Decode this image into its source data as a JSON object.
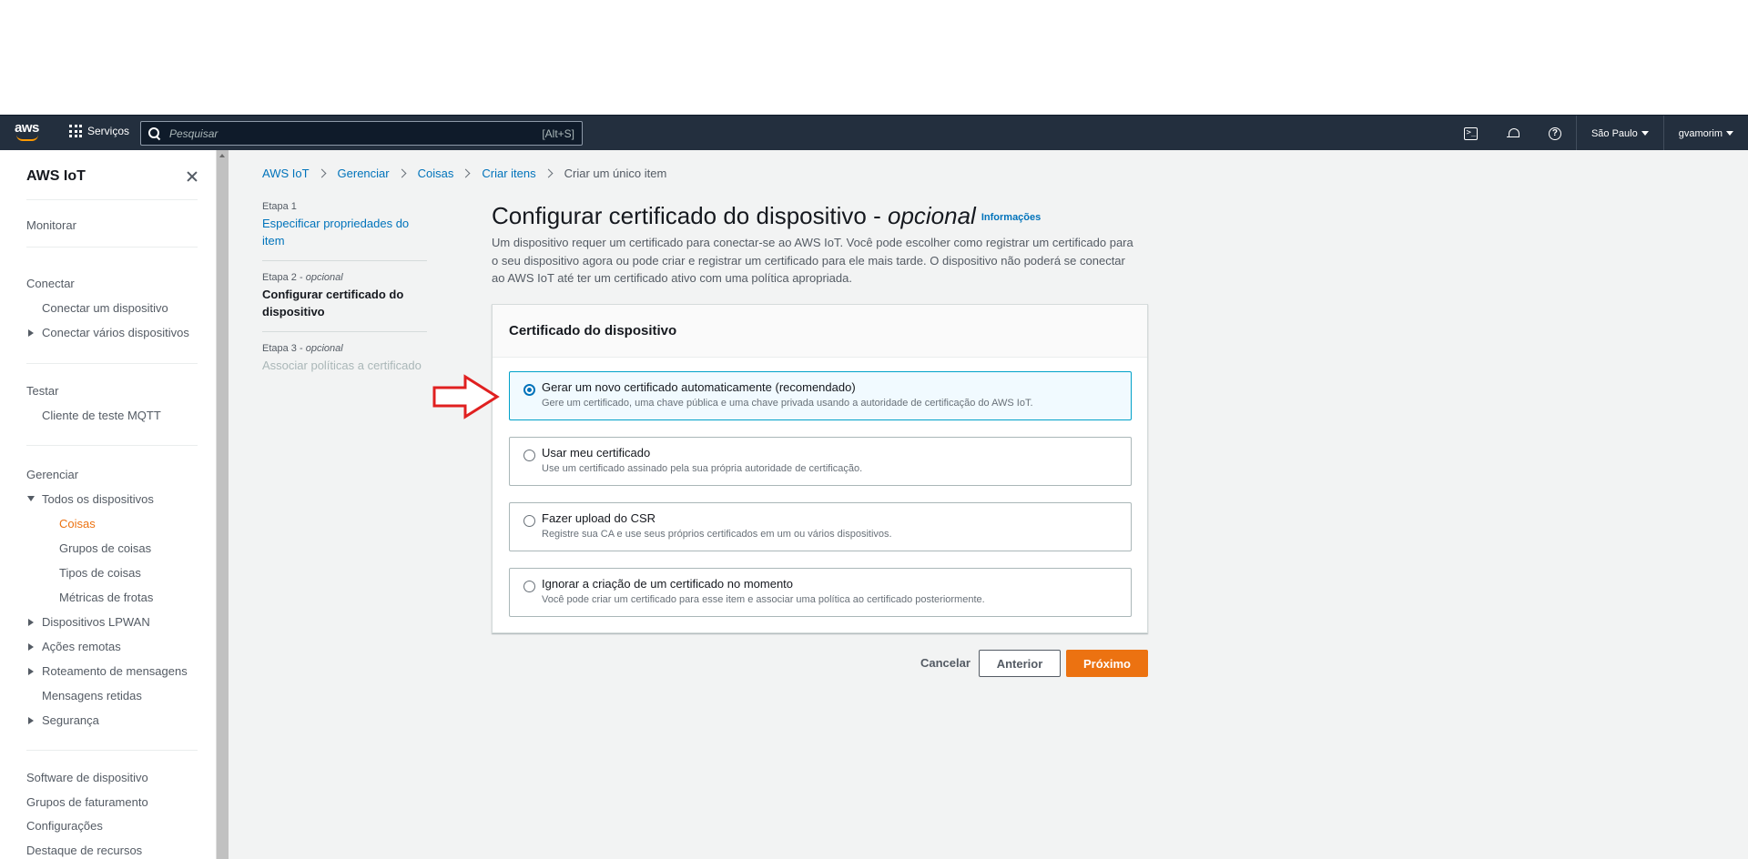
{
  "navbar": {
    "logo_text": "aws",
    "services_label": "Serviços",
    "search_placeholder": "Pesquisar",
    "search_shortcut": "[Alt+S]",
    "region": "São Paulo",
    "account": "gvamorim",
    "icons": [
      "cloudshell-icon",
      "bell-icon",
      "help-icon"
    ]
  },
  "sidebar": {
    "title": "AWS IoT",
    "monitor": "Monitorar",
    "connect": "Conectar",
    "connect_one": "Conectar um dispositivo",
    "connect_many": "Conectar vários dispositivos",
    "test": "Testar",
    "mqtt_client": "Cliente de teste MQTT",
    "manage": "Gerenciar",
    "all_devices": "Todos os dispositivos",
    "things": "Coisas",
    "thing_groups": "Grupos de coisas",
    "thing_types": "Tipos de coisas",
    "fleet_metrics": "Métricas de frotas",
    "lpwan": "Dispositivos LPWAN",
    "remote_actions": "Ações remotas",
    "message_routing": "Roteamento de mensagens",
    "retained_messages": "Mensagens retidas",
    "security": "Segurança",
    "device_software": "Software de dispositivo",
    "billing_groups": "Grupos de faturamento",
    "settings": "Configurações",
    "feature_spotlight": "Destaque de recursos"
  },
  "breadcrumb": {
    "items": [
      "AWS IoT",
      "Gerenciar",
      "Coisas",
      "Criar itens"
    ],
    "current": "Criar um único item"
  },
  "steps": [
    {
      "label": "Etapa 1",
      "optional": "",
      "title": "Especificar propriedades do item"
    },
    {
      "label": "Etapa 2 - ",
      "optional": "opcional",
      "title": "Configurar certificado do dispositivo"
    },
    {
      "label": "Etapa 3 - ",
      "optional": "opcional",
      "title": "Associar políticas a certificado"
    }
  ],
  "page": {
    "title": "Configurar certificado do dispositivo - ",
    "title_optional": "opcional",
    "info_link": "Informações",
    "description": "Um dispositivo requer um certificado para conectar-se ao AWS IoT. Você pode escolher como registrar um certificado para o seu dispositivo agora ou pode criar e registrar um certificado para ele mais tarde. O dispositivo não poderá se conectar ao AWS IoT até ter um certificado ativo com uma política apropriada."
  },
  "panel": {
    "title": "Certificado do dispositivo",
    "options": [
      {
        "title": "Gerar um novo certificado automaticamente (recomendado)",
        "desc": "Gere um certificado, uma chave pública e uma chave privada usando a autoridade de certificação do AWS IoT.",
        "selected": true
      },
      {
        "title": "Usar meu certificado",
        "desc": "Use um certificado assinado pela sua própria autoridade de certificação.",
        "selected": false
      },
      {
        "title": "Fazer upload do CSR",
        "desc": "Registre sua CA e use seus próprios certificados em um ou vários dispositivos.",
        "selected": false
      },
      {
        "title": "Ignorar a criação de um certificado no momento",
        "desc": "Você pode criar um certificado para esse item e associar uma política ao certificado posteriormente.",
        "selected": false
      }
    ]
  },
  "buttons": {
    "cancel": "Cancelar",
    "previous": "Anterior",
    "next": "Próximo"
  },
  "colors": {
    "navbar_bg": "#232f3e",
    "link": "#0073bb",
    "primary": "#ec7211",
    "annotation_arrow": "#e02020"
  }
}
